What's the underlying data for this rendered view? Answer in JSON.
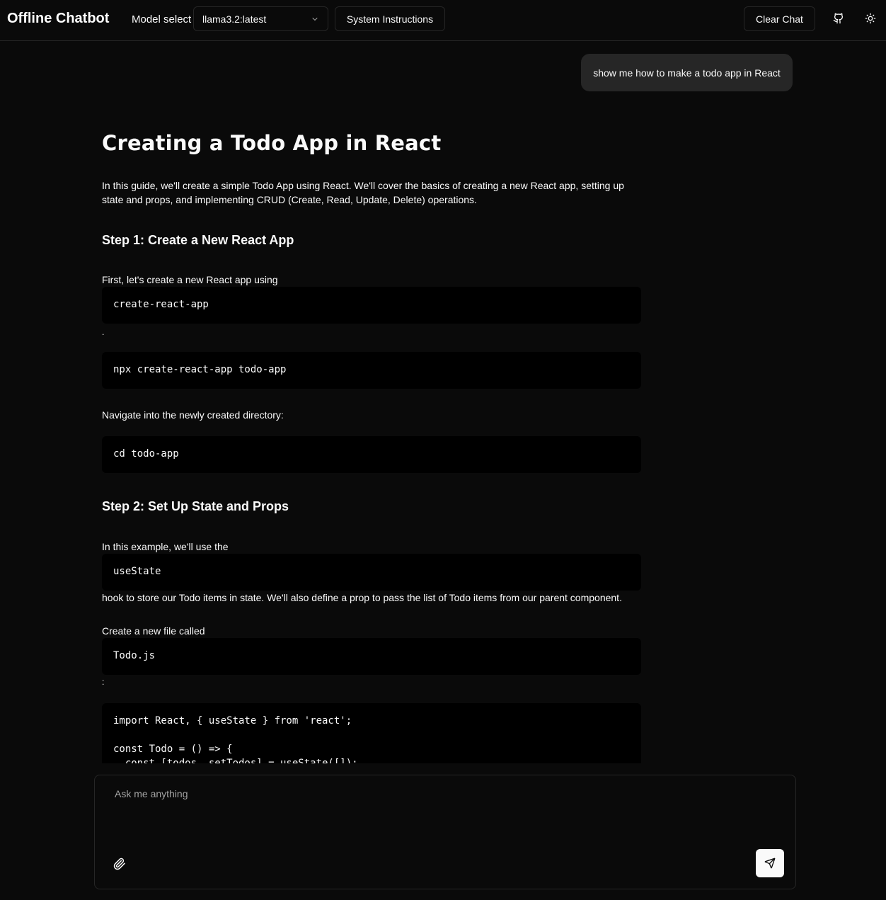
{
  "header": {
    "brand": "Offline Chatbot",
    "model_label": "Model select",
    "model_value": "llama3.2:latest",
    "system_instructions": "System Instructions",
    "clear_chat": "Clear Chat",
    "icons": [
      "github-icon",
      "sun-icon",
      "chevron-down-icon"
    ]
  },
  "user_message": "show me how to make a todo app in React",
  "response": {
    "title": "Creating a Todo App in React",
    "intro": "In this guide, we'll create a simple Todo App using React. We'll cover the basics of creating a new React app, setting up state and props, and implementing CRUD (Create, Read, Update, Delete) operations.",
    "step1_heading": "Step 1: Create a New React App",
    "step1_text": "First, let's create a new React app using",
    "step1_code1": "create-react-app",
    "step1_dot": ".",
    "step1_code2": "npx create-react-app todo-app",
    "navigate_text": "Navigate into the newly created directory:",
    "navigate_code": "cd todo-app",
    "step2_heading": "Step 2: Set Up State and Props",
    "step2_text": "In this example, we'll use the",
    "step2_code": "useState",
    "step2_text2": " hook to store our Todo items in state. We'll also define a prop to pass the list of Todo items from our parent component.",
    "create_text": "Create a new file called",
    "create_code": "Todo.js",
    "create_colon": ":",
    "code_lines": [
      "import React, { useState } from 'react';",
      "",
      "const Todo = () => {",
      "  const [todos, setTodos] = useState([]);"
    ]
  },
  "input": {
    "placeholder": "Ask me anything"
  }
}
